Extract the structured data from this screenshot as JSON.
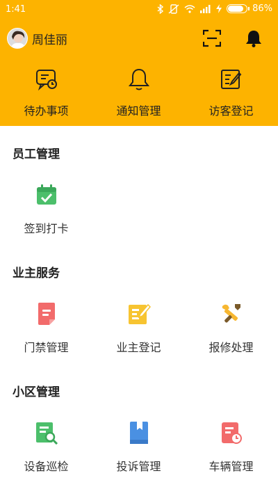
{
  "status": {
    "time": "1:41",
    "battery": "86%",
    "battery_level": 0.86
  },
  "user": {
    "name": "周佳丽"
  },
  "quick_actions": [
    {
      "label": "待办事项",
      "icon": "todo-chat-icon"
    },
    {
      "label": "通知管理",
      "icon": "bell-icon"
    },
    {
      "label": "访客登记",
      "icon": "edit-register-icon"
    }
  ],
  "sections": [
    {
      "title": "员工管理",
      "items": [
        {
          "label": "签到打卡",
          "icon": "calendar-check-icon",
          "color": "#4CBF6B"
        }
      ]
    },
    {
      "title": "业主服务",
      "items": [
        {
          "label": "门禁管理",
          "icon": "document-icon",
          "color": "#F26B6B"
        },
        {
          "label": "业主登记",
          "icon": "edit-icon",
          "color": "#F7C431"
        },
        {
          "label": "报修处理",
          "icon": "tools-icon",
          "color": "#F7B731"
        }
      ]
    },
    {
      "title": "小区管理",
      "items": [
        {
          "label": "设备巡检",
          "icon": "inspect-icon",
          "color": "#4CBF6B"
        },
        {
          "label": "投诉管理",
          "icon": "book-icon",
          "color": "#4A90E2"
        },
        {
          "label": "车辆管理",
          "icon": "vehicle-doc-icon",
          "color": "#F26B6B"
        }
      ]
    }
  ],
  "colors": {
    "header": "#FDB300"
  }
}
